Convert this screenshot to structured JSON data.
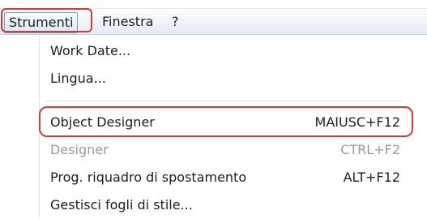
{
  "menubar": {
    "items": [
      {
        "label": "Strumenti"
      },
      {
        "label": "Finestra"
      },
      {
        "label": "?"
      }
    ]
  },
  "dropdown": {
    "items": [
      {
        "label": "Work Date...",
        "shortcut": "",
        "enabled": true
      },
      {
        "label": "Lingua...",
        "shortcut": "",
        "enabled": true
      },
      {
        "label": "Object Designer",
        "shortcut": "MAIUSC+F12",
        "enabled": true
      },
      {
        "label": "Designer",
        "shortcut": "CTRL+F2",
        "enabled": false
      },
      {
        "label": "Prog. riquadro di spostamento",
        "shortcut": "ALT+F12",
        "enabled": true
      },
      {
        "label": "Gestisci fogli di stile...",
        "shortcut": "",
        "enabled": true
      }
    ]
  },
  "colors": {
    "highlight_outline": "#d93838",
    "disabled_text": "#9a9a9a",
    "menubar_active_border": "#7d9ac7"
  }
}
